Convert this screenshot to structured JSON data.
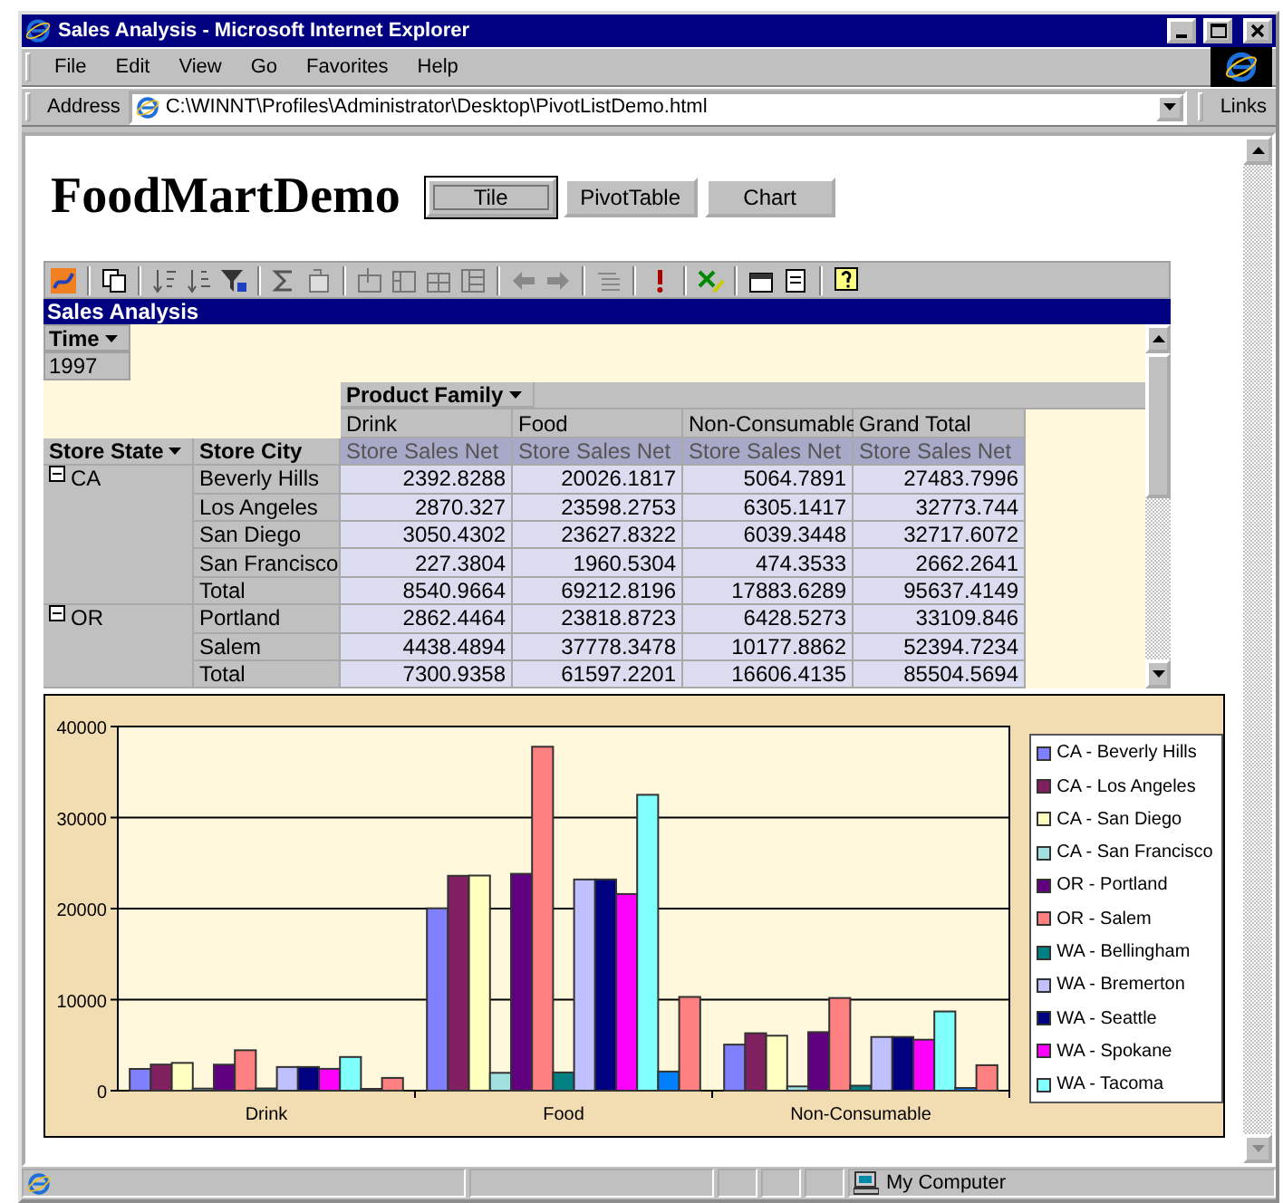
{
  "window": {
    "title": "Sales Analysis - Microsoft Internet Explorer"
  },
  "menu": [
    {
      "label": "File"
    },
    {
      "label": "Edit"
    },
    {
      "label": "View"
    },
    {
      "label": "Go"
    },
    {
      "label": "Favorites"
    },
    {
      "label": "Help"
    }
  ],
  "address": {
    "label": "Address",
    "value": "C:\\WINNT\\Profiles\\Administrator\\Desktop\\PivotListDemo.html",
    "links": "Links"
  },
  "page": {
    "heading": "FoodMartDemo",
    "buttons": [
      {
        "label": "Tile",
        "selected": true
      },
      {
        "label": "PivotTable",
        "selected": false
      },
      {
        "label": "Chart",
        "selected": false
      }
    ]
  },
  "pivot": {
    "title": "Sales Analysis",
    "filter": {
      "field": "Time",
      "value": "1997"
    },
    "column_field": "Product Family",
    "columns": [
      "Drink",
      "Food",
      "Non-Consumable",
      "Grand Total"
    ],
    "row_fields": [
      "Store State",
      "Store City"
    ],
    "measures": [
      "Store Sales Net",
      "Store Sales Net",
      "Store Sales Net",
      "Store Sales Net"
    ],
    "groups": [
      {
        "state": "CA",
        "expanded": true,
        "rows": [
          {
            "city": "Beverly Hills",
            "values": [
              "2392.8288",
              "20026.1817",
              "5064.7891",
              "27483.7996"
            ]
          },
          {
            "city": "Los Angeles",
            "values": [
              "2870.327",
              "23598.2753",
              "6305.1417",
              "32773.744"
            ]
          },
          {
            "city": "San Diego",
            "values": [
              "3050.4302",
              "23627.8322",
              "6039.3448",
              "32717.6072"
            ]
          },
          {
            "city": "San Francisco",
            "values": [
              "227.3804",
              "1960.5304",
              "474.3533",
              "2662.2641"
            ]
          },
          {
            "city": "Total",
            "values": [
              "8540.9664",
              "69212.8196",
              "17883.6289",
              "95637.4149"
            ]
          }
        ]
      },
      {
        "state": "OR",
        "expanded": true,
        "rows": [
          {
            "city": "Portland",
            "values": [
              "2862.4464",
              "23818.8723",
              "6428.5273",
              "33109.846"
            ]
          },
          {
            "city": "Salem",
            "values": [
              "4438.4894",
              "37778.3478",
              "10177.8862",
              "52394.7234"
            ]
          },
          {
            "city": "Total",
            "values": [
              "7300.9358",
              "61597.2201",
              "16606.4135",
              "85504.5694"
            ]
          }
        ]
      }
    ]
  },
  "chart": {
    "chart_data": {
      "type": "bar",
      "grid": true,
      "categories": [
        "Drink",
        "Food",
        "Non-Consumable"
      ],
      "ylim": [
        0,
        40000
      ],
      "yticks": [
        0,
        10000,
        20000,
        30000,
        40000
      ],
      "series": [
        {
          "name": "CA - Beverly Hills",
          "color": "#8080ff",
          "values": [
            2390,
            20030,
            5060
          ]
        },
        {
          "name": "CA - Los Angeles",
          "color": "#802060",
          "values": [
            2870,
            23600,
            6310
          ]
        },
        {
          "name": "CA - San Diego",
          "color": "#ffffc0",
          "values": [
            3050,
            23630,
            6040
          ]
        },
        {
          "name": "CA - San Francisco",
          "color": "#a0e0e0",
          "values": [
            230,
            1960,
            470
          ]
        },
        {
          "name": "OR - Portland",
          "color": "#600080",
          "values": [
            2860,
            23820,
            6430
          ]
        },
        {
          "name": "OR - Salem",
          "color": "#ff8080",
          "values": [
            4440,
            37780,
            10180
          ]
        },
        {
          "name": "WA - Bellingham",
          "color": "#008080",
          "values": [
            245,
            2000,
            550
          ]
        },
        {
          "name": "WA - Bremerton",
          "color": "#c0c0ff",
          "values": [
            2600,
            23200,
            5900
          ]
        },
        {
          "name": "WA - Seattle",
          "color": "#000080",
          "values": [
            2600,
            23200,
            5900
          ]
        },
        {
          "name": "WA - Spokane",
          "color": "#ff00ff",
          "values": [
            2400,
            21600,
            5600
          ]
        },
        {
          "name": "WA - Tacoma",
          "color": "#80ffff",
          "values": [
            3700,
            32500,
            8700
          ]
        },
        {
          "color": "#0080ff",
          "values": [
            200,
            2100,
            300
          ]
        },
        {
          "color": "#ff8080",
          "values": [
            1400,
            10300,
            2800
          ]
        }
      ]
    }
  },
  "status_bar": {
    "zone": "My Computer"
  }
}
